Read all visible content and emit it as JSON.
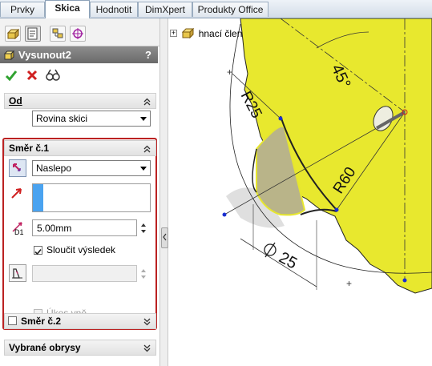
{
  "tabs": [
    {
      "label": "Prvky",
      "active": false
    },
    {
      "label": "Skica",
      "active": true
    },
    {
      "label": "Hodnotit",
      "active": false
    },
    {
      "label": "DimXpert",
      "active": false
    },
    {
      "label": "Produkty Office",
      "active": false
    }
  ],
  "feature_manager_tabs": [
    "feature-tree-icon",
    "property-manager-icon",
    "configuration-manager-icon",
    "dimxpert-manager-icon"
  ],
  "feature": {
    "title": "Vysunout2",
    "help": "?"
  },
  "actions": [
    "ok-icon",
    "cancel-icon",
    "preview-icon"
  ],
  "from_group": {
    "title": "Od",
    "start_condition": "Rovina skici"
  },
  "direction1": {
    "title": "Směr č.1",
    "end_condition": "Naslepo",
    "direction_field": "",
    "depth": "5.00mm",
    "depth_icon_label": "D1",
    "merge_label": "Sloučit výsledek",
    "merge_checked": true,
    "draft_value": "",
    "draft_outward_label": "Úkos vně",
    "draft_outward_checked": false
  },
  "direction2": {
    "title": "Směr č.2",
    "checked": false
  },
  "selected_contours": {
    "title": "Vybrané obrysy"
  },
  "tree": {
    "item": "hnací člen"
  },
  "sketch": {
    "dim_r25": "R25",
    "dim_45": "45°",
    "dim_r60": "R60",
    "dim_d25": "25"
  },
  "colors": {
    "part_fill": "#e8e82e",
    "highlight": "#bb2222",
    "title_bar": "#7a7a7a"
  }
}
